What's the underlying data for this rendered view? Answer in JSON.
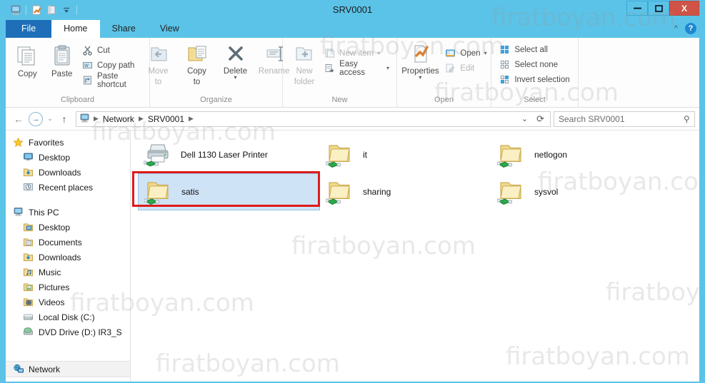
{
  "window": {
    "title": "SRV0001",
    "minimize_label": "—",
    "maximize_label": "❐",
    "close_label": "X"
  },
  "quick_access": [
    {
      "name": "this-pc-icon",
      "label": "This PC"
    },
    {
      "name": "properties-icon",
      "label": "Properties"
    },
    {
      "name": "new-folder-icon",
      "label": "New folder"
    },
    {
      "name": "customize-dropdown-icon",
      "label": "Customize Quick Access Toolbar"
    }
  ],
  "tabs": [
    {
      "label": "File",
      "type": "file"
    },
    {
      "label": "Home",
      "type": "active"
    },
    {
      "label": "Share",
      "type": "normal"
    },
    {
      "label": "View",
      "type": "normal"
    }
  ],
  "ribbon_right": {
    "collapse_label": "^",
    "help_label": "?"
  },
  "ribbon": {
    "groups": [
      {
        "title": "Clipboard",
        "big": [
          {
            "label": "Copy",
            "icon": "copy-icon",
            "disabled": false
          },
          {
            "label": "Paste",
            "icon": "paste-icon",
            "disabled": false
          }
        ],
        "small": [
          {
            "label": "Cut",
            "icon": "cut-icon",
            "disabled": false
          },
          {
            "label": "Copy path",
            "icon": "copy-path-icon",
            "disabled": false
          },
          {
            "label": "Paste shortcut",
            "icon": "paste-shortcut-icon",
            "disabled": false
          }
        ]
      },
      {
        "title": "Organize",
        "big": [
          {
            "label": "Move\nto",
            "label_l1": "Move",
            "label_l2": "to",
            "icon": "move-to-icon",
            "disabled": true,
            "caret": true
          },
          {
            "label": "Copy\nto",
            "label_l1": "Copy",
            "label_l2": "to",
            "icon": "copy-to-icon",
            "disabled": false,
            "caret": true
          },
          {
            "label": "Delete",
            "icon": "delete-icon",
            "disabled": false,
            "caret": true
          },
          {
            "label": "Rename",
            "icon": "rename-icon",
            "disabled": true,
            "caret": false
          }
        ],
        "small": []
      },
      {
        "title": "New",
        "big": [
          {
            "label_l1": "New",
            "label_l2": "folder",
            "icon": "new-folder-big-icon",
            "disabled": true,
            "caret": false
          }
        ],
        "small": [
          {
            "label": "New item",
            "icon": "new-item-icon",
            "disabled": true,
            "caret": true
          },
          {
            "label": "Easy access",
            "icon": "easy-access-icon",
            "disabled": false,
            "caret": true
          }
        ]
      },
      {
        "title": "Open",
        "big": [
          {
            "label": "Properties",
            "icon": "properties-big-icon",
            "disabled": false,
            "caret": true
          }
        ],
        "small": [
          {
            "label": "Open",
            "icon": "open-icon",
            "disabled": false,
            "caret": true
          },
          {
            "label": "Edit",
            "icon": "edit-icon",
            "disabled": true,
            "caret": false
          }
        ]
      },
      {
        "title": "Select",
        "big": [],
        "small": [
          {
            "label": "Select all",
            "icon": "select-all-icon",
            "disabled": false
          },
          {
            "label": "Select none",
            "icon": "select-none-icon",
            "disabled": false
          },
          {
            "label": "Invert selection",
            "icon": "invert-selection-icon",
            "disabled": false
          }
        ]
      }
    ]
  },
  "address_bar": {
    "back_label": "←",
    "forward_label": "→",
    "recent_label": "⌄",
    "up_label": "↑",
    "breadcrumbs": [
      {
        "label": "Network"
      },
      {
        "label": "SRV0001"
      }
    ],
    "history_label": "⌄",
    "refresh_label": "⟳"
  },
  "search": {
    "placeholder": "Search SRV0001",
    "value": "",
    "icon": "search-icon"
  },
  "sidebar": {
    "groups": [
      {
        "header": {
          "label": "Favorites",
          "icon": "star-icon"
        },
        "items": [
          {
            "label": "Desktop",
            "icon": "desktop-icon"
          },
          {
            "label": "Downloads",
            "icon": "downloads-icon"
          },
          {
            "label": "Recent places",
            "icon": "recent-places-icon"
          }
        ]
      },
      {
        "header": {
          "label": "This PC",
          "icon": "this-pc-icon"
        },
        "items": [
          {
            "label": "Desktop",
            "icon": "desktop-folder-icon"
          },
          {
            "label": "Documents",
            "icon": "documents-icon"
          },
          {
            "label": "Downloads",
            "icon": "downloads-icon"
          },
          {
            "label": "Music",
            "icon": "music-icon"
          },
          {
            "label": "Pictures",
            "icon": "pictures-icon"
          },
          {
            "label": "Videos",
            "icon": "videos-icon"
          },
          {
            "label": "Local Disk (C:)",
            "icon": "hard-disk-icon"
          },
          {
            "label": "DVD Drive (D:) IR3_S",
            "icon": "dvd-drive-icon"
          }
        ]
      }
    ],
    "network": {
      "label": "Network",
      "icon": "network-icon"
    }
  },
  "files": {
    "columns": [
      {
        "items": [
          {
            "name": "Dell 1130 Laser Printer",
            "icon": "shared-printer-icon",
            "selected": false
          },
          {
            "name": "satis",
            "icon": "shared-folder-icon",
            "selected": true
          }
        ]
      },
      {
        "items": [
          {
            "name": "it",
            "icon": "shared-folder-icon",
            "selected": false
          },
          {
            "name": "sharing",
            "icon": "shared-folder-icon",
            "selected": false
          }
        ]
      },
      {
        "items": [
          {
            "name": "netlogon",
            "icon": "shared-folder-icon",
            "selected": false
          },
          {
            "name": "sysvol",
            "icon": "shared-folder-icon",
            "selected": false
          }
        ]
      }
    ]
  },
  "annotation": {
    "highlight_color": "#e01b1b",
    "target": "satis"
  },
  "watermark": {
    "text": "firatboyan.com"
  },
  "colors": {
    "title_bar": "#5cc3e8",
    "file_tab": "#1e6fb8",
    "close_button": "#cf5447",
    "selection": "#cfe3f7",
    "annotation": "#e01b1b"
  }
}
